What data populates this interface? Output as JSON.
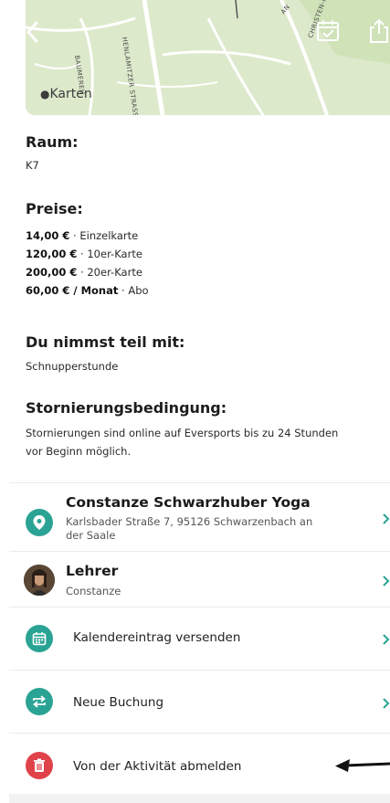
{
  "map": {
    "brand": "Karten",
    "street_1": "HENLAMITZER STRASSE",
    "street_2": "BAUMEREU",
    "street_3": "CHRISTEN-H",
    "street_4": "AN"
  },
  "room": {
    "heading": "Raum:",
    "value": "K7"
  },
  "prices": {
    "heading": "Preise:",
    "items": [
      {
        "price": "14,00 €",
        "label": " · Einzelkarte"
      },
      {
        "price": "120,00 €",
        "label": " · 10er-Karte"
      },
      {
        "price": "200,00 €",
        "label": " · 20er-Karte"
      },
      {
        "price": "60,00 € / Monat",
        "label": " · Abo"
      }
    ]
  },
  "participation": {
    "heading": "Du nimmst teil mit:",
    "value": "Schnupperstunde"
  },
  "cancellation": {
    "heading": "Stornierungsbedingung:",
    "line1": "Stornierungen sind online auf Eversports bis zu 24 Stunden",
    "line2": "vor Beginn möglich."
  },
  "studio": {
    "name": "Constanze Schwarzhuber Yoga",
    "address_line1": "Karlsbader Straße 7, 95126 Schwarzenbach an",
    "address_line2": "der Saale"
  },
  "teacher": {
    "title": "Lehrer",
    "name": "Constanze"
  },
  "actions": {
    "calendar": "Kalendereintrag versenden",
    "new_booking": "Neue Buchung",
    "unsubscribe": "Von der Aktivität abmelden"
  },
  "colors": {
    "teal": "#2aa394",
    "red": "#e0424a",
    "map": "#dce8c8"
  }
}
